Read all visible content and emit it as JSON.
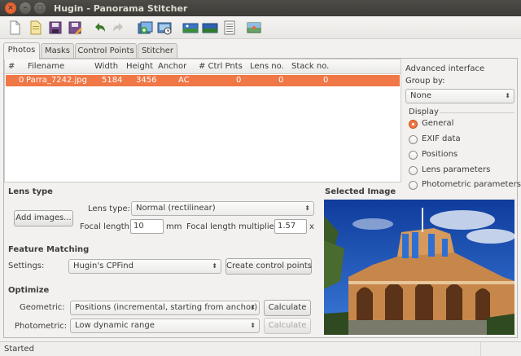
{
  "window": {
    "title": "Hugin - Panorama Stitcher"
  },
  "toolbar": {
    "buttons": [
      "new-project",
      "open-project",
      "save-project",
      "save-project-as",
      "undo",
      "redo",
      "add-images",
      "add-time-series",
      "preview",
      "fast-preview",
      "layout",
      "show-control-points"
    ]
  },
  "tabs": [
    {
      "label": "Photos",
      "active": true
    },
    {
      "label": "Masks"
    },
    {
      "label": "Control Points"
    },
    {
      "label": "Stitcher"
    }
  ],
  "image_list": {
    "columns": [
      "#",
      "Filename",
      "Width",
      "Height",
      "Anchor",
      "# Ctrl Pnts",
      "Lens no.",
      "Stack no."
    ],
    "rows": [
      {
        "num": "0",
        "filename": "Parra_7242.jpg",
        "width": "5184",
        "height": "3456",
        "anchor": "AC",
        "ctrl_pnts": "0",
        "lens": "0",
        "stack": "0"
      }
    ],
    "selection_color": "#f07746"
  },
  "sidebar": {
    "advanced_label": "Advanced interface",
    "group_by_label": "Group by:",
    "group_by_value": "None",
    "display_label": "Display",
    "display_options": [
      "General",
      "EXIF data",
      "Positions",
      "Lens parameters",
      "Photometric parameters"
    ],
    "display_selected": "General"
  },
  "lens": {
    "header": "Lens type",
    "add_images_label": "Add images...",
    "lens_type_label": "Lens type:",
    "lens_type_value": "Normal (rectilinear)",
    "focal_length_label": "Focal length:",
    "focal_length_value": "10",
    "focal_length_unit": "mm",
    "multiplier_label": "Focal length multiplier:",
    "multiplier_value": "1.57",
    "multiplier_unit": "x"
  },
  "feature_matching": {
    "header": "Feature Matching",
    "settings_label": "Settings:",
    "settings_value": "Hugin's CPFind",
    "create_cp_label": "Create control points"
  },
  "optimize": {
    "header": "Optimize",
    "geometric_label": "Geometric:",
    "geometric_value": "Positions (incremental, starting from anchor)",
    "geometric_calc_label": "Calculate",
    "photometric_label": "Photometric:",
    "photometric_value": "Low dynamic range",
    "photometric_calc_label": "Calculate"
  },
  "selected_image": {
    "header": "Selected Image"
  },
  "status": {
    "text": "Started"
  }
}
